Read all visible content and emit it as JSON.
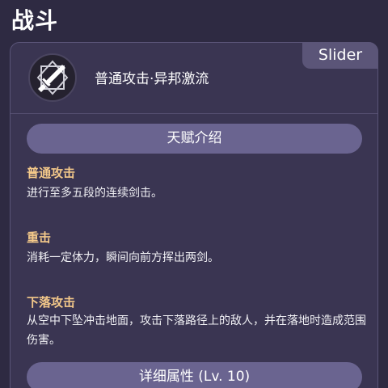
{
  "section": {
    "title": "战斗"
  },
  "skill": {
    "name": "普通攻击·异邦激流",
    "tag": "Slider",
    "icon": "sword-emblem-icon"
  },
  "talent_pill": {
    "label": "天赋介绍"
  },
  "attacks": [
    {
      "heading": "普通攻击",
      "description": "进行至多五段的连续剑击。"
    },
    {
      "heading": "重击",
      "description": "消耗一定体力，瞬间向前方挥出两剑。"
    },
    {
      "heading": "下落攻击",
      "description": "从空中下坠冲击地面，攻击下落路径上的敌人，并在落地时造成范围伤害。"
    }
  ],
  "details_pill": {
    "label": "详细属性 (Lv. 10)"
  },
  "colors": {
    "background": "#2e2a42",
    "card": "#3a3552",
    "pill": "#6a6490",
    "heading_accent": "#f4c98a"
  }
}
